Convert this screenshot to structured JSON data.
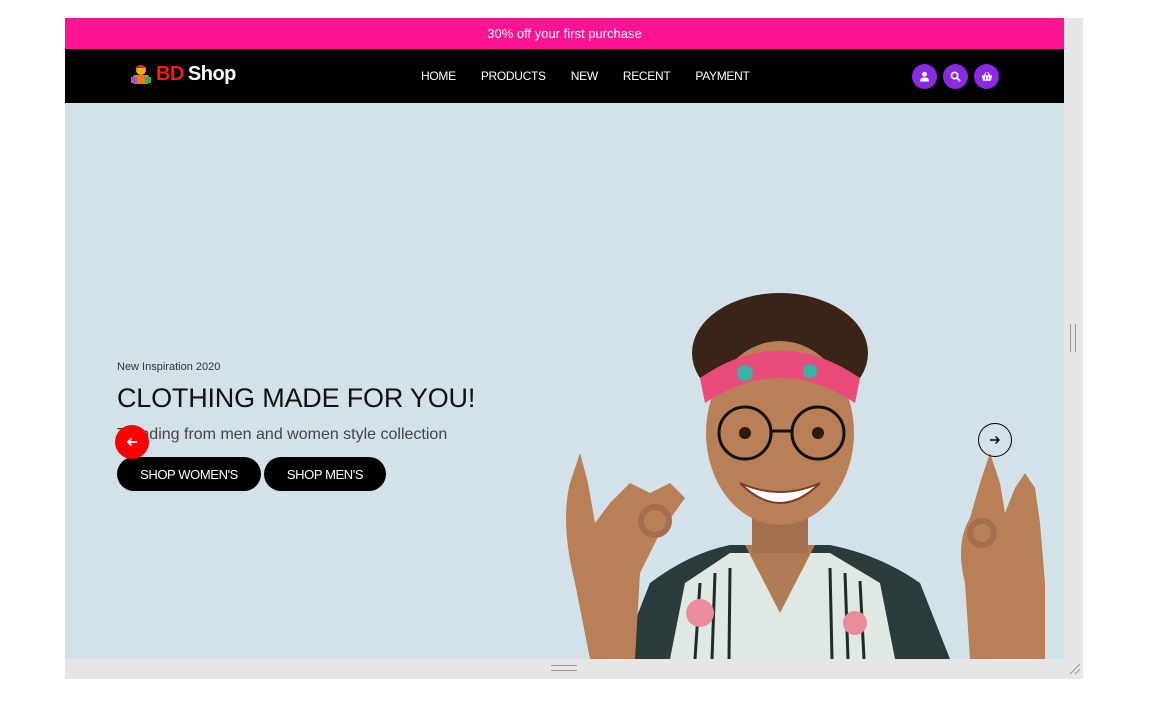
{
  "promo": {
    "text": "30% off your first purchase"
  },
  "brand": {
    "prefix": "BD",
    "name": "Shop",
    "logo_icon": "shopper-icon"
  },
  "nav": {
    "links": [
      "HOME",
      "PRODUCTS",
      "NEW",
      "RECENT",
      "PAYMENT"
    ],
    "icons": [
      "user-icon",
      "search-icon",
      "basket-icon"
    ]
  },
  "hero": {
    "eyebrow": "New Inspiration 2020",
    "headline": "CLOTHING MADE FOR YOU!",
    "subline": "Trending from men and women style collection",
    "buttons": {
      "women": "SHOP WOMEN'S",
      "men": "SHOP MEN'S"
    },
    "prev_icon": "arrow-left-icon",
    "next_icon": "arrow-right-icon"
  },
  "colors": {
    "promo_bg": "#ff1493",
    "nav_bg": "#000000",
    "brand_accent": "#ff1a1a",
    "icon_bg": "#8a2be2",
    "hero_bg": "#d3e2e8",
    "prev_arrow_bg": "#ff0000"
  }
}
